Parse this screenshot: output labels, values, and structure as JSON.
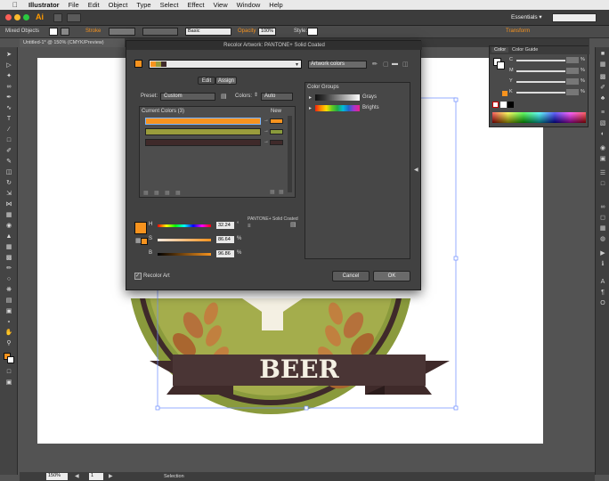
{
  "menubar": {
    "apple": "",
    "items": [
      "Illustrator",
      "File",
      "Edit",
      "Object",
      "Type",
      "Select",
      "Effect",
      "View",
      "Window",
      "Help"
    ]
  },
  "appbar": {
    "logo": "Ai",
    "workspace": "Essentials ▾"
  },
  "control_bar": {
    "selection_label": "Mixed Objects",
    "stroke_label": "Stroke",
    "brush_value": "Basic",
    "opacity_label": "Opacity",
    "opacity_value": "100%",
    "style_label": "Style:",
    "transform_label": "Transform"
  },
  "document": {
    "tab_title": "Untitled-1* @ 150% (CMYK/Preview)"
  },
  "artwork": {
    "beer_text": "BEER",
    "colors": {
      "ring": "#8a9a3c",
      "ring_dark": "#3f2a2a",
      "wheat": "#b5713b",
      "banner": "#3f2a2a",
      "orange": "#f7931e"
    }
  },
  "color_panel": {
    "tabs": [
      "Color",
      "Color Guide"
    ],
    "sliders": [
      {
        "key": "C",
        "value": ""
      },
      {
        "key": "M",
        "value": ""
      },
      {
        "key": "Y",
        "value": ""
      },
      {
        "key": "K",
        "value": ""
      }
    ],
    "percent": "%"
  },
  "recolor_dialog": {
    "title": "Recolor Artwork: PANTONE+ Solid Coated",
    "artwork_colors_field": "Artwork colors",
    "tab_edit": "Edit",
    "tab_assign": "Assign",
    "preset_label": "Preset:",
    "preset_value": "Custom",
    "colors_label": "Colors:",
    "colors_value": "Auto",
    "current_colors_label": "Current Colors (3)",
    "new_label": "New",
    "current_colors": [
      {
        "color": "#f7931e"
      },
      {
        "color": "#9a9c3c"
      },
      {
        "color": "#3f2a2a"
      }
    ],
    "hsb": [
      {
        "key": "H",
        "value": "32.24",
        "unit": "°"
      },
      {
        "key": "S",
        "value": "86.64",
        "unit": "%"
      },
      {
        "key": "B",
        "value": "96.86",
        "unit": "%"
      }
    ],
    "library_label": "PANTONE+ Solid Coated",
    "color_groups_label": "Color Groups",
    "groups": [
      {
        "name": "Grays"
      },
      {
        "name": "Brights"
      }
    ],
    "recolor_art_label": "Recolor Art",
    "cancel_label": "Cancel",
    "ok_label": "OK"
  },
  "status_bar": {
    "zoom": "150%",
    "page": "1",
    "tool": "Selection"
  }
}
